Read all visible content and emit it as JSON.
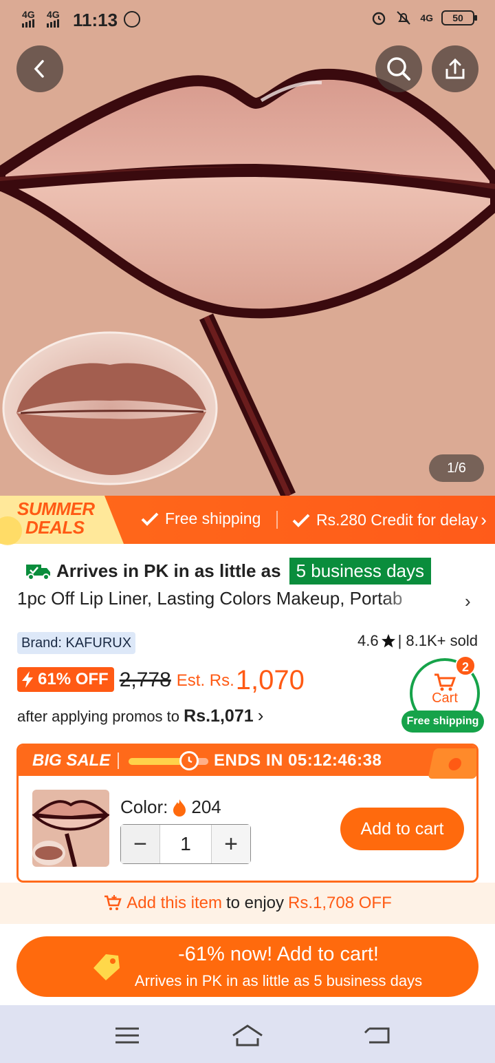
{
  "status_bar": {
    "signal_1": "4G",
    "signal_2": "4G",
    "time": "11:13",
    "net": "4G",
    "battery": "50"
  },
  "gallery": {
    "counter": "1/6",
    "icons": [
      "back-arrow-icon",
      "search-icon",
      "share-icon"
    ]
  },
  "summer_banner": {
    "line1": "SUMMER",
    "line2": "DEALS",
    "item1": "Free shipping",
    "item2": "Rs.280 Credit for delay",
    "chevron": "›"
  },
  "product": {
    "arrives_prefix": "Arrives in PK in as little as",
    "arrives_days": "5 business days",
    "title": "1pc Off Lip Liner, Lasting Colors Makeup, Portab",
    "title_chevron": "›",
    "brand": "Brand: KAFURUX",
    "rating": "4.6",
    "sold": "| 8.1K+ sold",
    "discount": "61% OFF",
    "old_price": "2,778",
    "est_label": "Est. Rs.",
    "est_price": "1,070",
    "promo_prefix": "after applying promos to",
    "promo_price": "Rs.1,071",
    "promo_chevron": "›"
  },
  "cart": {
    "label": "Cart",
    "count": "2",
    "free_shipping": "Free shipping"
  },
  "big_sale": {
    "title": "BIG SALE",
    "ends_label": "ENDS IN",
    "countdown": "05:12:46:38",
    "color_label": "Color:",
    "color_value": "204",
    "quantity": "1",
    "minus": "−",
    "plus": "+",
    "add_to_cart": "Add to cart"
  },
  "promo_strip": {
    "link": "Add this item",
    "middle": "to enjoy",
    "amount": "Rs.1,708 OFF"
  },
  "cta": {
    "line1": "-61% now! Add to cart!",
    "line2": "Arrives in PK in as little as 5 business days"
  },
  "colors": {
    "accent": "#ff6a0d",
    "green": "#0a8d3c",
    "strip_bg": "#fef2e6",
    "nav_bg": "#dfe2f2"
  }
}
